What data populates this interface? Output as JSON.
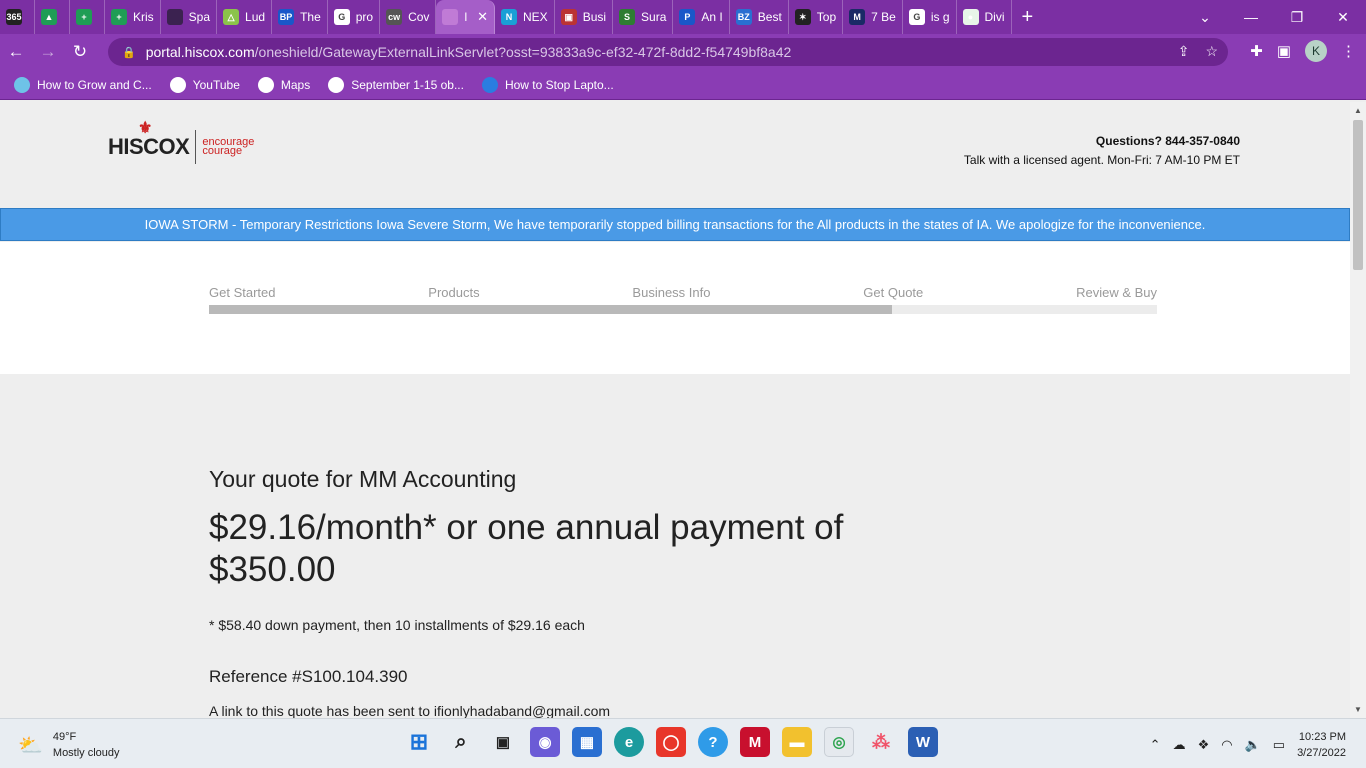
{
  "browser": {
    "tabs": [
      {
        "label": "",
        "icon": "365"
      },
      {
        "label": "",
        "icon": "▲"
      },
      {
        "label": "",
        "icon": "+"
      },
      {
        "label": "Kris",
        "icon": "+"
      },
      {
        "label": "Spa",
        "icon": ""
      },
      {
        "label": "Lud",
        "icon": "△"
      },
      {
        "label": "The",
        "icon": "BP"
      },
      {
        "label": "pro",
        "icon": "G"
      },
      {
        "label": "Cov",
        "icon": "cw"
      },
      {
        "label": "l",
        "icon": "",
        "active": true
      },
      {
        "label": "NEX",
        "icon": "N"
      },
      {
        "label": "Busi",
        "icon": "▣"
      },
      {
        "label": "Sura",
        "icon": "S"
      },
      {
        "label": "An I",
        "icon": "P"
      },
      {
        "label": "Best",
        "icon": "BZ"
      },
      {
        "label": "Top",
        "icon": "✶"
      },
      {
        "label": "7 Be",
        "icon": "M"
      },
      {
        "label": "is g",
        "icon": "G"
      },
      {
        "label": "Divi",
        "icon": "●"
      }
    ],
    "new_tab": "+",
    "url_host": "portal.hiscox.com",
    "url_path": "/oneshield/GatewayExternalLinkServlet?osst=93833a9c-ef32-472f-8dd2-f54749bf8a42",
    "avatar_letter": "K",
    "bookmarks": [
      "How to Grow and C...",
      "YouTube",
      "Maps",
      "September 1-15 ob...",
      "How to Stop Lapto..."
    ]
  },
  "header": {
    "brand": "HISCOX",
    "tagline_1": "encourage",
    "tagline_2": "courage",
    "questions": "Questions?  844-357-0840",
    "hours": "Talk with a licensed agent.  Mon-Fri: 7 AM-10 PM ET"
  },
  "banner": "IOWA STORM - Temporary Restrictions Iowa Severe Storm, We have temporarily stopped billing transactions for the All products in the states of IA. We apologize for the inconvenience.",
  "progress": {
    "steps": [
      "Get Started",
      "Products",
      "Business Info",
      "Get Quote",
      "Review & Buy"
    ],
    "fill_fraction": 0.72
  },
  "quote": {
    "title": "Your quote for MM Accounting",
    "price": "$29.16/month* or one annual payment of $350.00",
    "note": "* $58.40 down payment, then 10 installments of $29.16 each",
    "reference": "Reference #S100.104.390",
    "sent": "A link to this quote has been sent to ifionlyhadaband@gmail.com"
  },
  "taskbar": {
    "temp": "49°F",
    "condition": "Mostly cloudy",
    "time": "10:23 PM",
    "date": "3/27/2022"
  },
  "colors": {
    "tab_bar": "#7b2fa3",
    "banner": "#4a9ae6",
    "brand_red": "#cc2222"
  }
}
